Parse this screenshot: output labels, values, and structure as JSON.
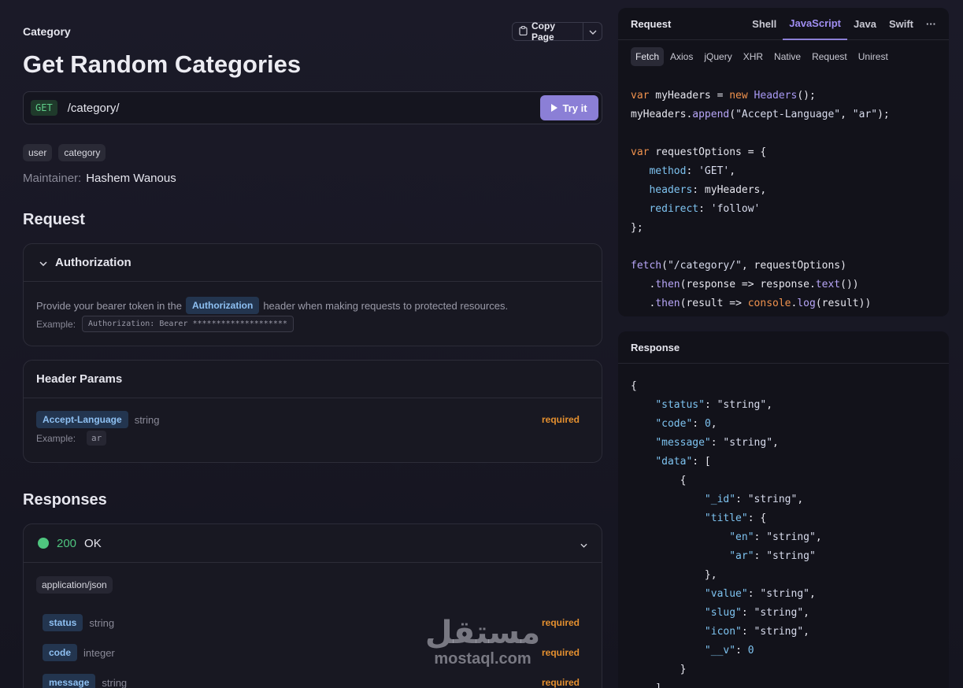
{
  "header": {
    "category_label": "Category",
    "copy_page_label": "Copy Page",
    "title": "Get Random Categories"
  },
  "endpoint": {
    "method": "GET",
    "path": "/category/",
    "try_label": "Try it"
  },
  "tags": [
    "user",
    "category"
  ],
  "maintainer": {
    "label": "Maintainer:",
    "name": "Hashem Wanous"
  },
  "request_section": {
    "title": "Request",
    "authorization": {
      "title": "Authorization",
      "desc_before": "Provide your bearer token in the",
      "chip": "Authorization",
      "desc_after": "header when making requests to protected resources.",
      "example_label": "Example:",
      "example_value": "Authorization: Bearer ********************"
    },
    "header_params": {
      "title": "Header Params",
      "param": {
        "name": "Accept-Language",
        "type": "string",
        "required": "required"
      },
      "example_label": "Example:",
      "example_value": "ar"
    }
  },
  "responses_section": {
    "title": "Responses",
    "status_code": "200",
    "status_text": "OK",
    "content_type": "application/json",
    "fields": [
      {
        "name": "status",
        "type": "string",
        "required": "required"
      },
      {
        "name": "code",
        "type": "integer",
        "required": "required"
      },
      {
        "name": "message",
        "type": "string",
        "required": "required"
      }
    ]
  },
  "watermark": {
    "arabic": "مستقل",
    "latin": "mostaql.com"
  },
  "request_panel": {
    "title": "Request",
    "lang_tabs": [
      "Shell",
      "JavaScript",
      "Java",
      "Swift"
    ],
    "active_lang": "JavaScript",
    "more_label": "···",
    "lib_tabs": [
      "Fetch",
      "Axios",
      "jQuery",
      "XHR",
      "Native",
      "Request",
      "Unirest"
    ],
    "active_lib": "Fetch"
  },
  "response_panel": {
    "title": "Response"
  },
  "colors": {
    "accent": "#8b7fd6",
    "success": "#4fc57f",
    "required": "#e5902f",
    "chip_bg": "#23354f",
    "chip_text": "#8ec0f2"
  }
}
